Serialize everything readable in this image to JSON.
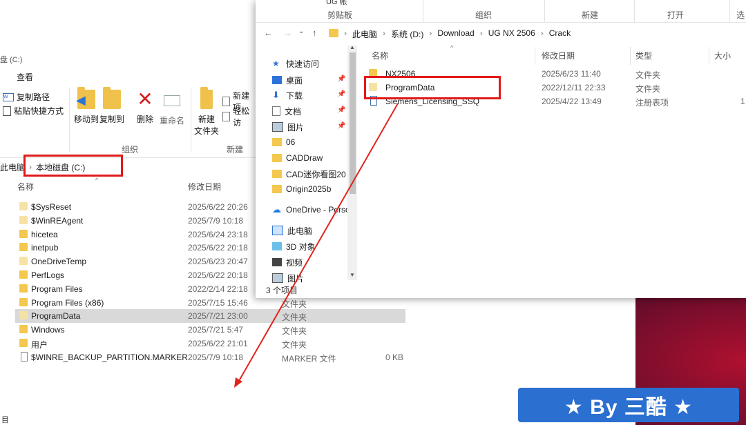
{
  "left_window": {
    "title": "盘 (C:)",
    "menu_view": "查看",
    "ribbon": {
      "copy_path": "复制路径",
      "paste_shortcut": "粘贴快捷方式",
      "move_to": "移动到",
      "copy_to": "复制到",
      "delete": "删除",
      "rename": "重命名",
      "new_folder_line1": "新建",
      "new_folder_line2": "文件夹",
      "new_item": "新建项",
      "easy_access": "轻松访",
      "group_organize": "组织",
      "group_new": "新建"
    },
    "address": [
      "此电脑",
      "本地磁盘 (C:)"
    ],
    "columns": {
      "name": "名称",
      "date": "修改日期"
    },
    "files": [
      {
        "name": "$SysReset",
        "date": "2025/6/22 20:26",
        "type": "",
        "size": "",
        "kind": "folder-pale"
      },
      {
        "name": "$WinREAgent",
        "date": "2025/7/9 10:18",
        "type": "",
        "size": "",
        "kind": "folder-pale"
      },
      {
        "name": "hicetea",
        "date": "2025/6/24 23:18",
        "type": "",
        "size": "",
        "kind": "folder"
      },
      {
        "name": "inetpub",
        "date": "2025/6/22 20:18",
        "type": "",
        "size": "",
        "kind": "folder"
      },
      {
        "name": "OneDriveTemp",
        "date": "2025/6/23 20:47",
        "type": "",
        "size": "",
        "kind": "folder-pale"
      },
      {
        "name": "PerfLogs",
        "date": "2025/6/22 20:18",
        "type": "",
        "size": "",
        "kind": "folder"
      },
      {
        "name": "Program Files",
        "date": "2022/2/14 22:18",
        "type": "",
        "size": "",
        "kind": "folder"
      },
      {
        "name": "Program Files (x86)",
        "date": "2025/7/15 15:46",
        "type": "文件夹",
        "size": "",
        "kind": "folder"
      },
      {
        "name": "ProgramData",
        "date": "2025/7/21 23:00",
        "type": "文件夹",
        "size": "",
        "kind": "folder-pale",
        "selected": true
      },
      {
        "name": "Windows",
        "date": "2025/7/21 5:47",
        "type": "文件夹",
        "size": "",
        "kind": "folder"
      },
      {
        "name": "用户",
        "date": "2025/6/22 21:01",
        "type": "文件夹",
        "size": "",
        "kind": "folder"
      },
      {
        "name": "$WINRE_BACKUP_PARTITION.MARKER",
        "date": "2025/7/9 10:18",
        "type": "MARKER 文件",
        "size": "0 KB",
        "kind": "file"
      }
    ],
    "status": "目"
  },
  "right_window": {
    "ribbon_top": {
      "top_label": "UG 帐",
      "clipboard": "剪贴板",
      "organize": "组织",
      "new": "新建",
      "open": "打开",
      "select": "选"
    },
    "address": [
      "此电脑",
      "系统 (D:)",
      "Download",
      "UG NX 2506",
      "Crack"
    ],
    "columns": {
      "name": "名称",
      "date": "修改日期",
      "type": "类型",
      "size": "大小"
    },
    "files": [
      {
        "name": "NX2506",
        "date": "2025/6/23 11:40",
        "type": "文件夹",
        "size": "",
        "kind": "folder"
      },
      {
        "name": "ProgramData",
        "date": "2022/12/11 22:33",
        "type": "文件夹",
        "size": "",
        "kind": "folder-pale"
      },
      {
        "name": "Siemens_Licensing_SSQ",
        "date": "2025/4/22 13:49",
        "type": "注册表项",
        "size": "1",
        "kind": "reg"
      }
    ],
    "nav": [
      {
        "label": "快速访问",
        "icon": "star-icon",
        "pinned": false
      },
      {
        "label": "桌面",
        "icon": "desktop-icon",
        "pinned": true
      },
      {
        "label": "下载",
        "icon": "download-icon",
        "pinned": true
      },
      {
        "label": "文档",
        "icon": "document-icon",
        "pinned": true
      },
      {
        "label": "图片",
        "icon": "picture-icon",
        "pinned": true
      },
      {
        "label": "06",
        "icon": "folder-icon",
        "pinned": false
      },
      {
        "label": "CADDraw",
        "icon": "folder-icon",
        "pinned": false
      },
      {
        "label": "CAD迷你看图20",
        "icon": "folder-icon",
        "pinned": false
      },
      {
        "label": "Origin2025b",
        "icon": "folder-icon",
        "pinned": false
      },
      {
        "label": "OneDrive - Perso",
        "icon": "cloud-icon",
        "pinned": false
      },
      {
        "label": "此电脑",
        "icon": "computer-icon",
        "pinned": false
      },
      {
        "label": "3D 对象",
        "icon": "cube-icon",
        "pinned": false
      },
      {
        "label": "视频",
        "icon": "video-icon",
        "pinned": false
      },
      {
        "label": "图片",
        "icon": "picture-icon",
        "pinned": false
      }
    ],
    "status": "3 个项目"
  },
  "watermark": "★ By 三酷 ★",
  "colors": {
    "highlight": "#e01919",
    "folder": "#f4c84e",
    "watermark_bg": "#2b6fd1"
  }
}
